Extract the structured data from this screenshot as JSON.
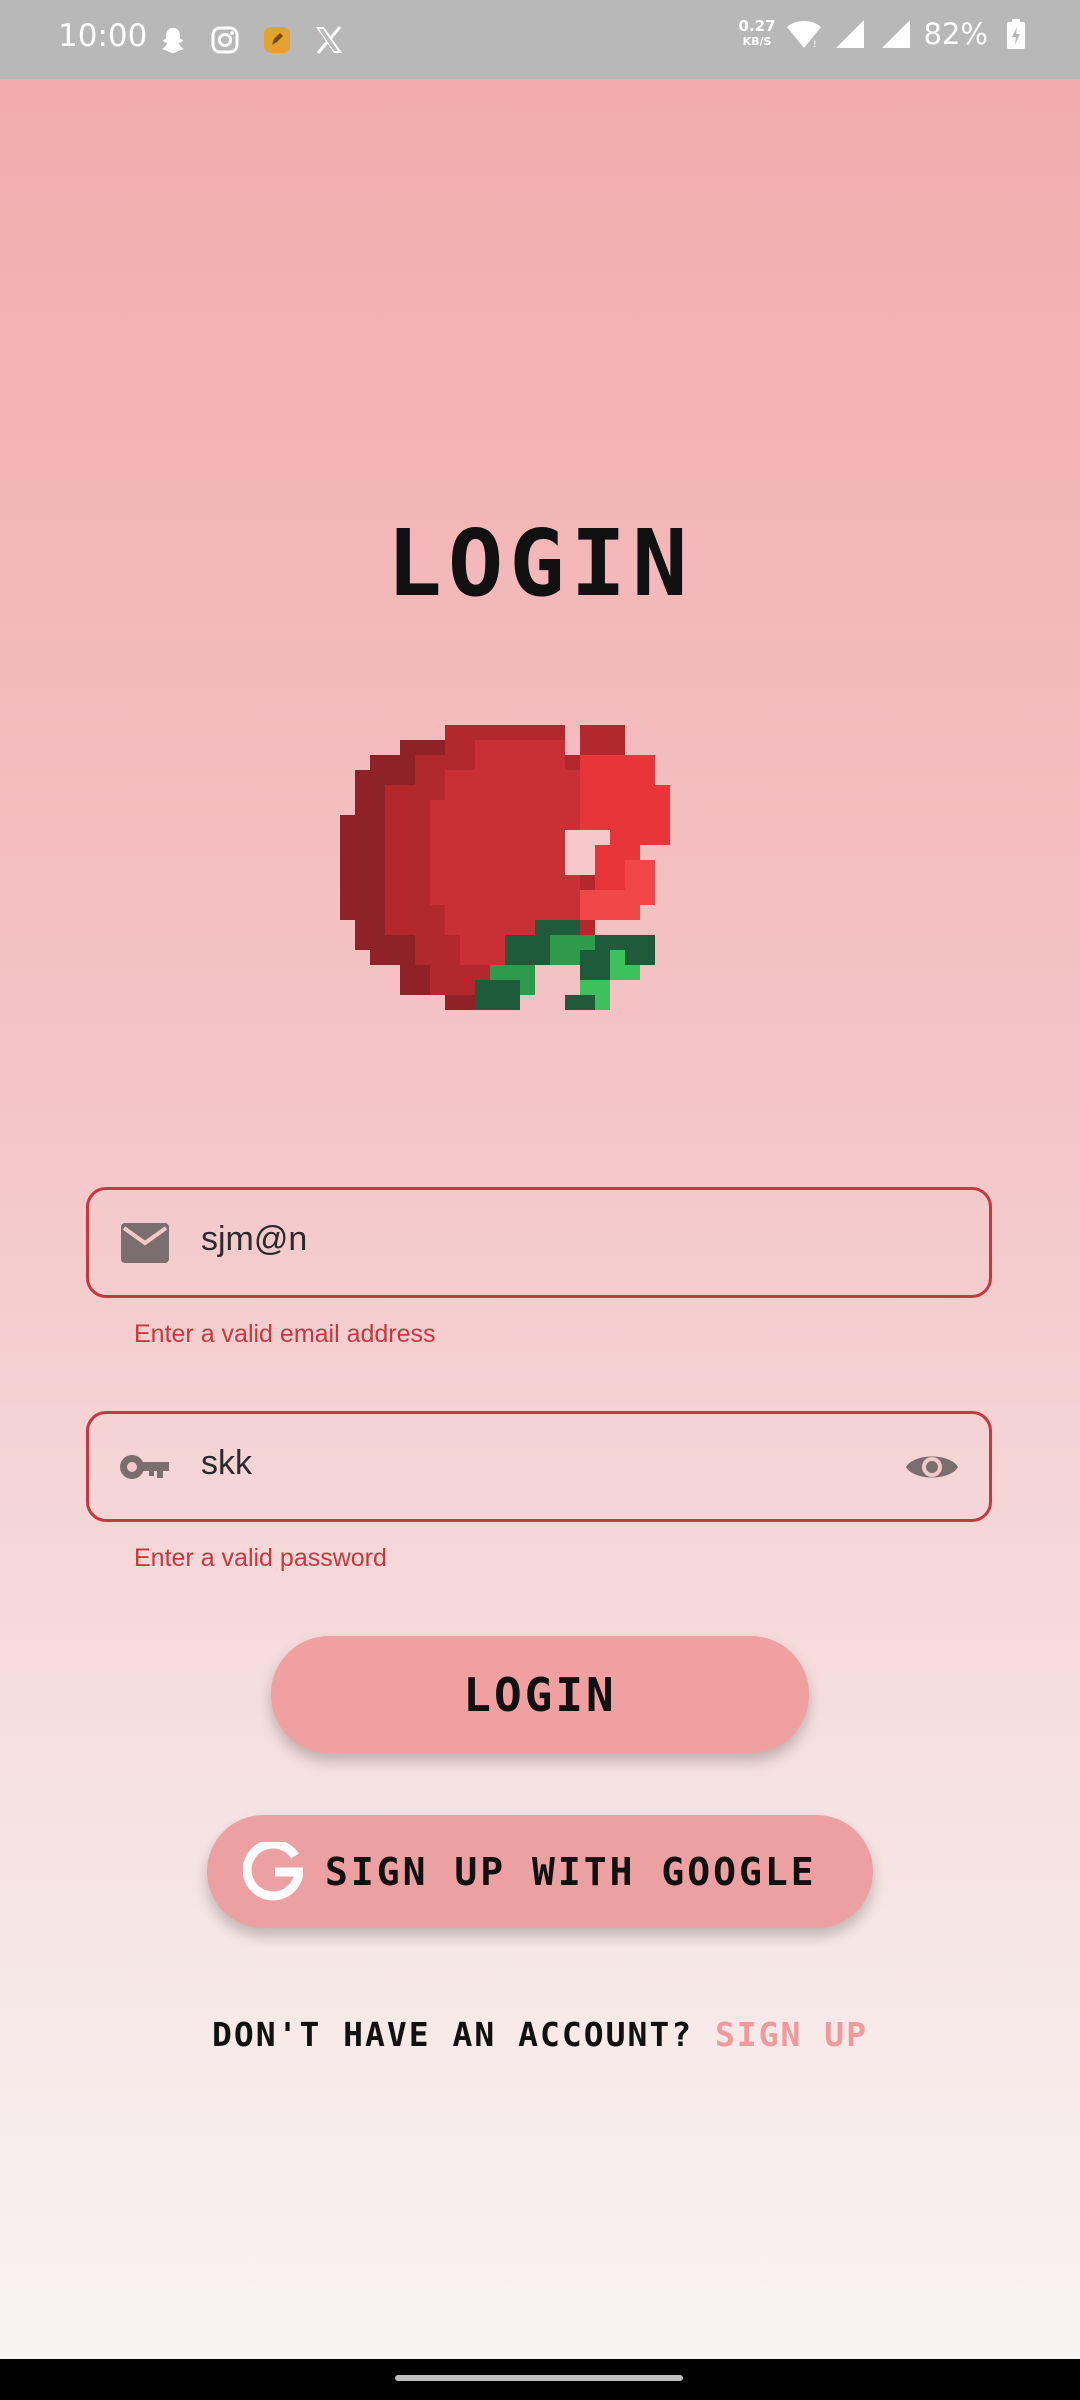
{
  "status_bar": {
    "time": "10:00",
    "left_icons": [
      "snapchat-icon",
      "instagram-icon",
      "notes-app-icon",
      "x-icon"
    ],
    "net_speed_value": "0.27",
    "net_speed_unit": "KB/S",
    "battery_percent": "82%"
  },
  "page": {
    "title": "LOGIN"
  },
  "email_field": {
    "icon": "mail-icon",
    "value": "sjm@n",
    "error": "Enter a valid email address"
  },
  "password_field": {
    "icon": "key-icon",
    "value": "skk",
    "toggle_icon": "eye-icon",
    "error": "Enter a valid password"
  },
  "buttons": {
    "login_label": "LOGIN",
    "google_label": "SIGN UP WITH GOOGLE"
  },
  "signup": {
    "prompt": "DON'T HAVE AN ACCOUNT?",
    "link": "SIGN UP"
  },
  "colors": {
    "accent": "#c9373e",
    "button_bg": "#f0a0a1",
    "link": "#f09a9c"
  }
}
